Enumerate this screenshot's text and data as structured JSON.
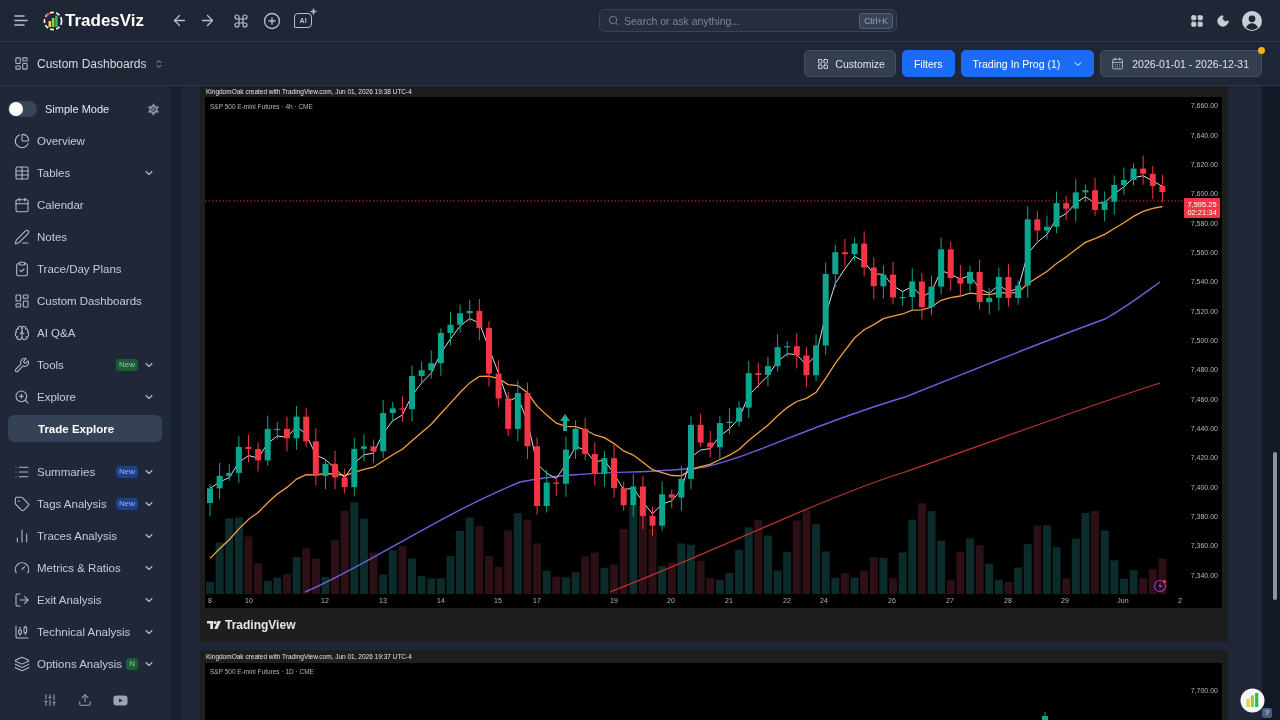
{
  "top_bar": {
    "brand": "TradesViz",
    "ai_button": "AI",
    "search": {
      "placeholder": "Search or ask anything...",
      "shortcut": "Ctrl+K"
    }
  },
  "sub_bar": {
    "dashboard": "Custom Dashboards",
    "customize": "Customize",
    "filters": "Filters",
    "trading_filter": "Trading In Prog (1)",
    "date_range": {
      "label": "2026-01-01 - 2026-12-31",
      "modified": true
    }
  },
  "sidebar": {
    "simple_mode": {
      "label": "Simple Mode",
      "on": false
    },
    "items": [
      {
        "label": "Overview",
        "selected": false,
        "expandable": false
      },
      {
        "label": "Tables",
        "selected": false,
        "expandable": true
      },
      {
        "label": "Calendar",
        "selected": false,
        "expandable": false
      },
      {
        "label": "Notes",
        "selected": false,
        "expandable": false
      },
      {
        "label": "Trace/Day Plans",
        "selected": false,
        "expandable": false
      },
      {
        "label": "Custom Dashboards",
        "selected": false,
        "expandable": false
      },
      {
        "label": "AI Q&A",
        "selected": false,
        "expandable": false
      },
      {
        "label": "Tools",
        "selected": false,
        "expandable": true,
        "badge": {
          "text": "New",
          "color": "#1b5e35"
        }
      },
      {
        "label": "Explore",
        "selected": false,
        "expandable": true,
        "children": [
          {
            "label": "Trade Explore",
            "selected": true
          }
        ]
      },
      {
        "label": "Summaries",
        "selected": false,
        "expandable": true,
        "badge": {
          "text": "New",
          "color": "#1e3f8f"
        }
      },
      {
        "label": "Tags Analysis",
        "selected": false,
        "expandable": true,
        "badge": {
          "text": "New",
          "color": "#1e3f8f"
        }
      },
      {
        "label": "Traces Analysis",
        "selected": false,
        "expandable": true
      },
      {
        "label": "Metrics & Ratios",
        "selected": false,
        "expandable": true
      },
      {
        "label": "Exit Analysis",
        "selected": false,
        "expandable": true
      },
      {
        "label": "Technical Analysis",
        "selected": false,
        "expandable": true
      },
      {
        "label": "Options Analysis",
        "selected": false,
        "expandable": true,
        "badge": {
          "text": "N",
          "color": "#1b5e35"
        }
      }
    ]
  },
  "charts": [
    {
      "kind": "intraday",
      "caption": "KingdomOak created with TradingView.com, Jun 01, 2026 19:38 UTC-4",
      "symbol": "S&P 500 E-mini Futures · 4h · CME",
      "y_labels": [
        "7,660.00",
        "7,640.00",
        "7,620.00",
        "7,600.00",
        "7,580.00",
        "7,560.00",
        "7,540.00",
        "7,520.00",
        "7,500.00",
        "7,480.00",
        "7,460.00",
        "7,440.00",
        "7,420.00",
        "7,400.00",
        "7,380.00",
        "7,360.00",
        "7,340.00"
      ],
      "x_labels": [
        "8",
        "10",
        "12",
        "13",
        "14",
        "15",
        "17",
        "19",
        "20",
        "21",
        "22",
        "24",
        "26",
        "27",
        "28",
        "29",
        "Jun",
        "2"
      ],
      "price": "7,595.25",
      "countdown": "02:21:34",
      "footer": "TradingView"
    },
    {
      "kind": "daily",
      "caption": "KingdomOak created with TradingView.com, Jun 01, 2026 19:37 UTC-4",
      "symbol": "S&P 500 E-mini Futures · 1D · CME",
      "y_labels": [
        "7,700.00"
      ]
    }
  ],
  "help_badge": "?"
}
